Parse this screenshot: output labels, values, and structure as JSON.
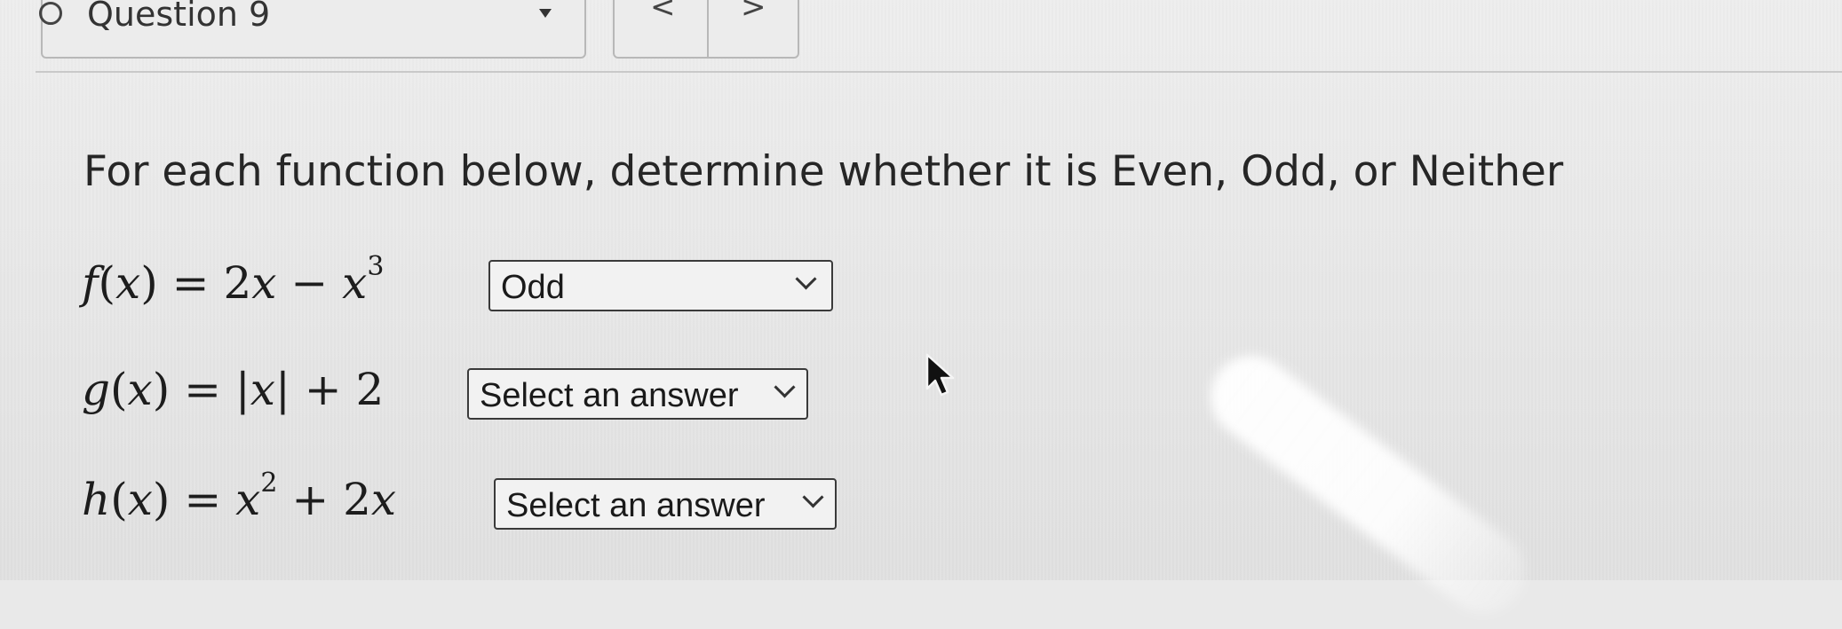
{
  "header": {
    "question_label": "Question 9",
    "prev_label": "<",
    "next_label": ">"
  },
  "instructions": "For each function below, determine whether it is Even, Odd, or Neither",
  "functions": [
    {
      "name": "f",
      "variable": "x",
      "expression": "2x − x^3",
      "selected": "Odd"
    },
    {
      "name": "g",
      "variable": "x",
      "expression": "|x| + 2",
      "selected": "Select an answer"
    },
    {
      "name": "h",
      "variable": "x",
      "expression": "x^2 + 2x",
      "selected": "Select an answer"
    }
  ],
  "math_tokens": {
    "f_name": "f",
    "g_name": "g",
    "h_name": "h",
    "var": "x",
    "f_rhs_coef": "2",
    "f_exp": "3",
    "g_const": "2",
    "h_exp": "2",
    "h_coef": "2"
  },
  "icons": {
    "question_status": "radio-circle-icon",
    "question_dropdown": "caret-down-icon",
    "select_chevron": "chevron-down-icon",
    "cursor": "mouse-pointer-icon"
  }
}
